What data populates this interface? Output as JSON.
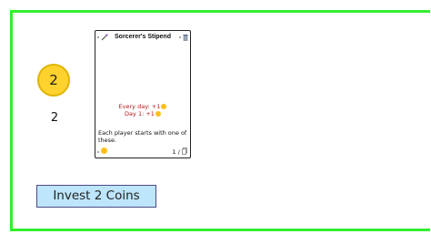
{
  "coin_badge": {
    "value": "2"
  },
  "coin_count": "2",
  "card": {
    "title": "Sorcerer's Stipend",
    "top_left_icon": "wand-icon",
    "top_right_icon": "trash-icon",
    "effects": [
      {
        "label": "Every day:",
        "bonus": "+1"
      },
      {
        "label": "Day 1:",
        "bonus": "+1"
      }
    ],
    "description": "Each player starts with one of these.",
    "quantity": "1 /",
    "quantity_icon": "card-stack-icon"
  },
  "invest_button": {
    "label": "Invest 2 Coins"
  },
  "colors": {
    "panel_border": "#33ee33",
    "coin": "#ffd22e",
    "effect_text": "#b01818",
    "button_bg": "#bde5fb"
  }
}
